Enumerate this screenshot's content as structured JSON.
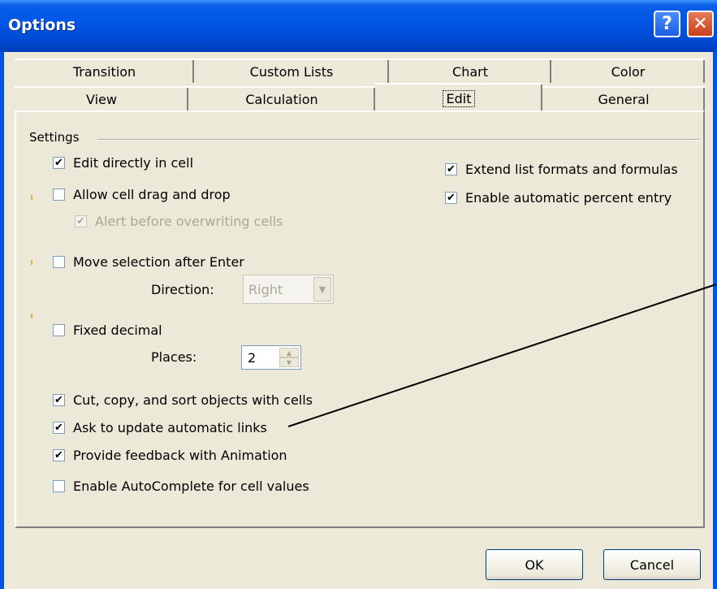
{
  "window": {
    "title": "Options",
    "help_glyph": "?",
    "close_glyph": "✕"
  },
  "tabs_row1": [
    {
      "label": "Transition"
    },
    {
      "label": "Custom Lists"
    },
    {
      "label": "Chart"
    },
    {
      "label": "Color"
    }
  ],
  "tabs_row2": [
    {
      "label": "View"
    },
    {
      "label": "Calculation"
    },
    {
      "label": "Edit",
      "active": true
    },
    {
      "label": "General"
    }
  ],
  "settings": {
    "title": "Settings",
    "edit_directly": {
      "label": "Edit directly in cell",
      "checked": true
    },
    "allow_drag_drop": {
      "label": "Allow cell drag and drop",
      "checked": false
    },
    "alert_overwrite": {
      "label": "Alert before overwriting cells",
      "checked": true,
      "enabled": false
    },
    "move_selection": {
      "label": "Move selection after Enter",
      "checked": false
    },
    "direction": {
      "label": "Direction:",
      "value": "Right"
    },
    "fixed_decimal": {
      "label": "Fixed decimal",
      "checked": false
    },
    "places": {
      "label": "Places:",
      "value": "2"
    },
    "cut_copy_sort": {
      "label": "Cut, copy, and sort objects with cells",
      "checked": true
    },
    "ask_update_links": {
      "label": "Ask to update automatic links",
      "checked": true
    },
    "provide_feedback": {
      "label": "Provide feedback with Animation",
      "checked": true
    },
    "autocomplete": {
      "label": "Enable AutoComplete for cell values",
      "checked": false
    },
    "extend_list": {
      "label": "Extend list formats and formulas",
      "checked": true
    },
    "auto_percent": {
      "label": "Enable automatic percent entry",
      "checked": true
    }
  },
  "buttons": {
    "ok": "OK",
    "cancel": "Cancel"
  },
  "check_glyph": "✔"
}
